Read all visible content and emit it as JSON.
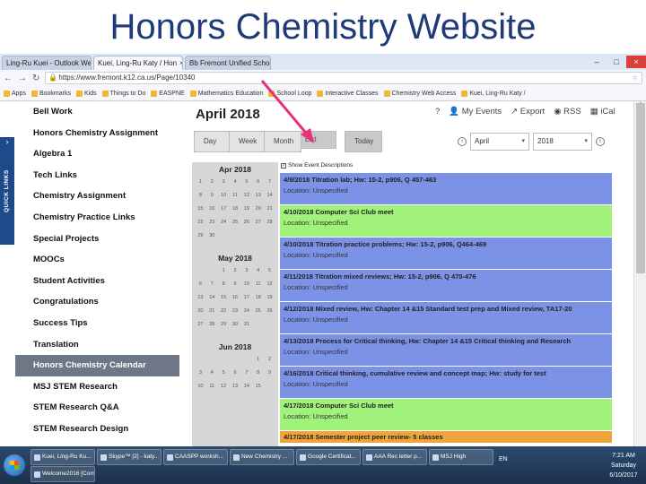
{
  "slide_title": "Honors Chemistry Website",
  "browser": {
    "tabs": [
      {
        "label": "Ling-Ru Kuei - Outlook We",
        "active": false
      },
      {
        "label": "Kuei, Ling-Ru Katy / Hon",
        "active": true
      },
      {
        "label": "Bb Fremont Unified School",
        "active": false
      }
    ],
    "url": "https://www.fremont.k12.ca.us/Page/10340",
    "bookmarks": [
      "Apps",
      "Bookmarks",
      "Kids",
      "Things to Do",
      "EASPNE",
      "Mathematics Education",
      "School Loop",
      "Interactive Classes",
      "Chemistry Web Access",
      "Kuei, Ling-Ru Katy /"
    ]
  },
  "quick_links": {
    "label": "QUICK LINKS",
    "arrow": "›"
  },
  "sidebar": {
    "items": [
      {
        "label": "Bell Work"
      },
      {
        "label": "Honors Chemistry Assignment"
      },
      {
        "label": "Algebra 1"
      },
      {
        "label": "Tech Links"
      },
      {
        "label": "Chemistry Assignment"
      },
      {
        "label": "Chemistry Practice Links"
      },
      {
        "label": "Special Projects"
      },
      {
        "label": "MOOCs"
      },
      {
        "label": "Student Activities"
      },
      {
        "label": "Congratulations"
      },
      {
        "label": "Success Tips"
      },
      {
        "label": "Translation"
      },
      {
        "label": "Honors Chemistry Calendar",
        "active": true
      },
      {
        "label": "MSJ STEM Research"
      },
      {
        "label": "STEM Research Q&A"
      },
      {
        "label": "STEM Research Design"
      }
    ]
  },
  "calendar": {
    "title": "April 2018",
    "top_links": {
      "my_events": "My Events",
      "export": "Export",
      "rss": "RSS",
      "ical": "iCal"
    },
    "view_buttons": [
      "Day",
      "Week",
      "Month",
      "List"
    ],
    "today_label": "Today",
    "month_select": "April",
    "year_select": "2018",
    "show_desc_label": "Show Event Descriptions",
    "mini_months": [
      {
        "name": "Apr 2018",
        "days": [
          "1",
          "2",
          "3",
          "4",
          "5",
          "6",
          "7",
          "8",
          "9",
          "10",
          "11",
          "12",
          "13",
          "14",
          "15",
          "16",
          "17",
          "18",
          "19",
          "20",
          "21",
          "22",
          "23",
          "24",
          "25",
          "26",
          "27",
          "28",
          "29",
          "30"
        ]
      },
      {
        "name": "May 2018",
        "days": [
          "1",
          "2",
          "3",
          "4",
          "5",
          "6",
          "7",
          "8",
          "9",
          "10",
          "11",
          "12",
          "13",
          "14",
          "15",
          "16",
          "17",
          "18",
          "19",
          "20",
          "21",
          "22",
          "23",
          "24",
          "25",
          "26",
          "27",
          "28",
          "29",
          "30",
          "31"
        ]
      },
      {
        "name": "Jun 2018",
        "days": [
          "1",
          "2",
          "3",
          "4",
          "5",
          "6",
          "7",
          "8",
          "9",
          "10",
          "11",
          "12",
          "13",
          "14",
          "15"
        ]
      }
    ],
    "events": [
      {
        "title": "4/9/2018 Titration lab; Hw: 15-2, p906, Q 457-463",
        "location": "Location: Unspecified",
        "color": "blue"
      },
      {
        "title": "4/10/2018 Computer Sci Club meet",
        "location": "Location: Unspecified",
        "color": "green"
      },
      {
        "title": "4/10/2018 Titration practice problems; Hw: 15-2, p906, Q464-469",
        "location": "Location: Unspecified",
        "color": "blue"
      },
      {
        "title": "4/11/2018 Titration mixed reviews; Hw: 15-2, p906, Q 470-476",
        "location": "Location: Unspecified",
        "color": "blue"
      },
      {
        "title": "4/12/2018 Mixed review, Hw: Chapter 14 &15 Standard test prep and Mixed review, TA17-20",
        "location": "Location: Unspecified",
        "color": "blue"
      },
      {
        "title": "4/13/2018 Process for Critical thinking, Hw: Chapter 14 &15 Critical thinking and Research",
        "location": "Location: Unspecified",
        "color": "blue"
      },
      {
        "title": "4/16/2018 Critical thinking, cumulative review and concept map; Hw: study for test",
        "location": "Location: Unspecified",
        "color": "blue"
      },
      {
        "title": "4/17/2018 Computer Sci Club meet",
        "location": "Location: Unspecified",
        "color": "green"
      },
      {
        "title": "4/17/2018 Semester project peer review- 5 classes",
        "location": "",
        "color": "orange"
      }
    ],
    "colors": {
      "blue": "#7b92e6",
      "green": "#a0f27a",
      "orange": "#f0a53a"
    }
  },
  "taskbar": {
    "items": [
      "Kuei, Ling-Ru Ku...",
      "Skype™ [2] - katy...",
      "CAASPP worksh...",
      "New Chemistry ...",
      "Google Certificat...",
      "AAA Rec letter p...",
      "MSJ High",
      "Welcome2016 [Com..."
    ],
    "lang": "EN",
    "time": "7:21 AM",
    "day": "Saturday",
    "date": "6/10/2017"
  }
}
